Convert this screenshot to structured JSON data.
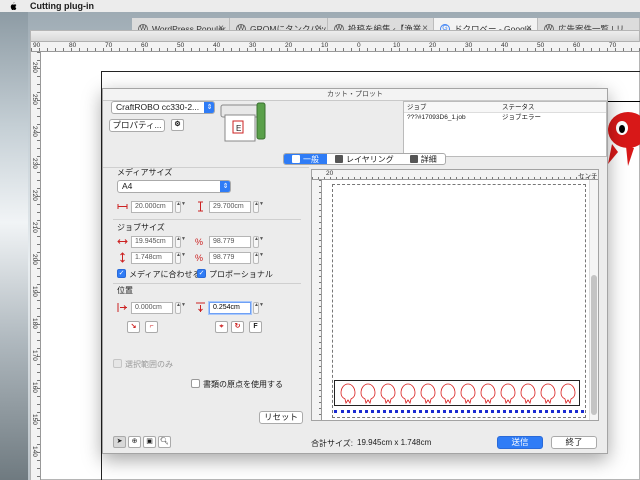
{
  "menubar": {
    "app_name": "Cutting plug-in"
  },
  "browser": {
    "tabs": [
      {
        "label": "WordPress Popular",
        "icon": "wordpress-icon",
        "active": false
      },
      {
        "label": "GROMにタンクバッ",
        "icon": "wordpress-icon",
        "active": false
      },
      {
        "label": "投稿を編集 ‹【漁業",
        "icon": "wordpress-icon",
        "active": false
      },
      {
        "label": "ドクロベー - Google",
        "icon": "google-icon",
        "active": true
      },
      {
        "label": "広告案件一覧 | リ",
        "icon": "wordpress-icon",
        "active": false
      }
    ]
  },
  "illustrator": {
    "ruler_labels": [
      "90",
      "80",
      "70",
      "60",
      "50",
      "40",
      "30",
      "20",
      "10",
      "0",
      "10",
      "20",
      "30",
      "40",
      "50",
      "60",
      "70"
    ],
    "left_ruler_labels": [
      "260",
      "250",
      "240",
      "230",
      "220",
      "210",
      "200",
      "190",
      "180",
      "170",
      "160",
      "150",
      "140"
    ]
  },
  "dialog": {
    "title": "カット・プロット",
    "device": "CraftROBO cc330-2...",
    "properties_button": "プロパティ...",
    "job_list": {
      "columns": [
        "ジョブ",
        "ステータス"
      ],
      "rows": [
        {
          "job": "???#17093D6_1.job",
          "status": "ジョブエラー"
        }
      ]
    },
    "tabs": [
      {
        "label": "一般",
        "active": true
      },
      {
        "label": "レイヤリング",
        "active": false
      },
      {
        "label": "詳細",
        "active": false
      }
    ],
    "media_size": {
      "section_label": "メディアサイズ",
      "value": "A4",
      "width": "20.000cm",
      "height": "29.700cm"
    },
    "job_size": {
      "section_label": "ジョブサイズ",
      "width": "19.945cm",
      "width_pct": "98.779",
      "height": "1.748cm",
      "height_pct": "98.779",
      "fit_media_label": "メディアに合わせる",
      "fit_media_checked": true,
      "proportional_label": "プロポーショナル",
      "proportional_checked": true
    },
    "position": {
      "section_label": "位置",
      "x": "0.000cm",
      "y": "0.254cm",
      "f_button": "F"
    },
    "selection_only_label": "選択範囲のみ",
    "use_doc_origin_label": "書類の原点を使用する",
    "reset_button": "リセット",
    "preview_ruler_labels": [
      "20",
      "10",
      "0",
      "10",
      "20",
      "30",
      "40",
      "50",
      "60",
      "70",
      "80",
      "90",
      "100",
      "110",
      "120",
      "130",
      "140",
      "センチ"
    ],
    "total_size_label": "合計サイズ:",
    "total_size_value": "19.945cm x 1.748cm",
    "send_button": "送信",
    "close_button": "終了"
  },
  "colors": {
    "accent": "#2f7cf6",
    "design_red": "#d81818",
    "baseline_blue": "#1a2bd1"
  }
}
